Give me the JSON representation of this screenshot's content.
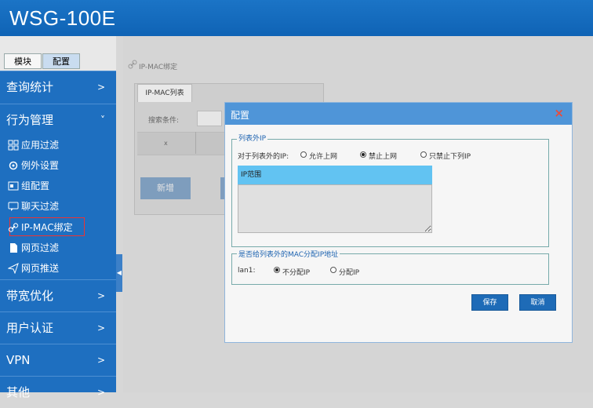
{
  "app": {
    "title": "WSG-100E"
  },
  "sidebar": {
    "tabs": [
      "模块",
      "配置"
    ],
    "sections": {
      "query": "查询统计",
      "behavior": "行为管理",
      "bandwidth": "带宽优化",
      "auth": "用户认证",
      "vpn": "VPN",
      "other": "其他"
    },
    "chevrons": {
      "right": ">",
      "down": "˅"
    },
    "subitems": [
      "应用过滤",
      "例外设置",
      "组配置",
      "聊天过滤",
      "IP-MAC绑定",
      "网页过滤",
      "网页推送"
    ]
  },
  "main": {
    "breadcrumb": "IP-MAC绑定",
    "tab": "IP-MAC列表",
    "search_label": "搜索条件:",
    "grid_x": "x",
    "add_button": "新增"
  },
  "dialog": {
    "title": "配置",
    "close": "×",
    "section1": {
      "legend": "列表外IP",
      "question": "对于列表外的IP:",
      "options": [
        "允许上网",
        "禁止上网",
        "只禁止下列IP"
      ],
      "selected": 1,
      "ip_header": "IP范围"
    },
    "section2": {
      "legend": "是否给列表外的MAC分配IP地址",
      "iface": "lan1:",
      "options": [
        "不分配IP",
        "分配IP"
      ],
      "selected": 0
    },
    "save": "保存",
    "cancel": "取消"
  }
}
